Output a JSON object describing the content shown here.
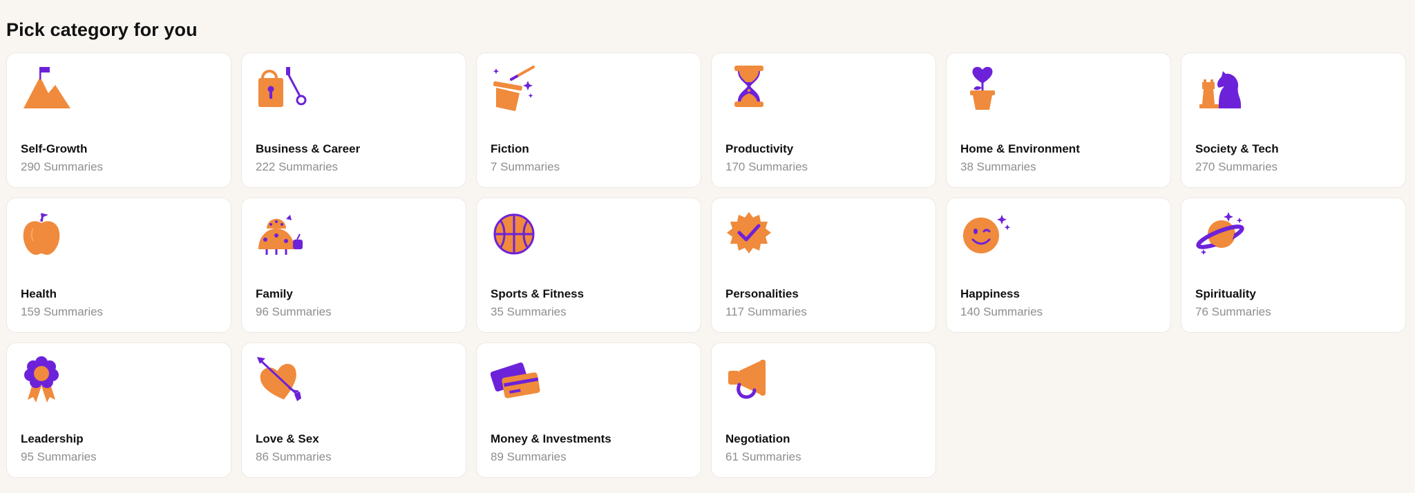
{
  "page": {
    "title": "Pick category for you"
  },
  "colors": {
    "accent_orange": "#f08a3c",
    "accent_purple": "#6c22d9"
  },
  "categories": [
    {
      "name": "Self-Growth",
      "count": "290 Summaries",
      "icon": "mountain-flag-icon"
    },
    {
      "name": "Business & Career",
      "count": "222 Summaries",
      "icon": "briefcase-key-icon"
    },
    {
      "name": "Fiction",
      "count": "7 Summaries",
      "icon": "magic-hat-icon"
    },
    {
      "name": "Productivity",
      "count": "170 Summaries",
      "icon": "hourglass-icon"
    },
    {
      "name": "Home & Environment",
      "count": "38 Summaries",
      "icon": "heart-plant-icon"
    },
    {
      "name": "Society & Tech",
      "count": "270 Summaries",
      "icon": "chess-pieces-icon"
    },
    {
      "name": "Health",
      "count": "159 Summaries",
      "icon": "apple-icon"
    },
    {
      "name": "Family",
      "count": "96 Summaries",
      "icon": "ladybug-family-icon"
    },
    {
      "name": "Sports & Fitness",
      "count": "35 Summaries",
      "icon": "basketball-icon"
    },
    {
      "name": "Personalities",
      "count": "117 Summaries",
      "icon": "badge-check-icon"
    },
    {
      "name": "Happiness",
      "count": "140 Summaries",
      "icon": "winking-smiley-icon"
    },
    {
      "name": "Spirituality",
      "count": "76 Summaries",
      "icon": "planet-icon"
    },
    {
      "name": "Leadership",
      "count": "95 Summaries",
      "icon": "award-ribbon-icon"
    },
    {
      "name": "Love & Sex",
      "count": "86 Summaries",
      "icon": "heart-arrow-icon"
    },
    {
      "name": "Money & Investments",
      "count": "89 Summaries",
      "icon": "credit-cards-icon"
    },
    {
      "name": "Negotiation",
      "count": "61 Summaries",
      "icon": "megaphone-icon"
    }
  ]
}
